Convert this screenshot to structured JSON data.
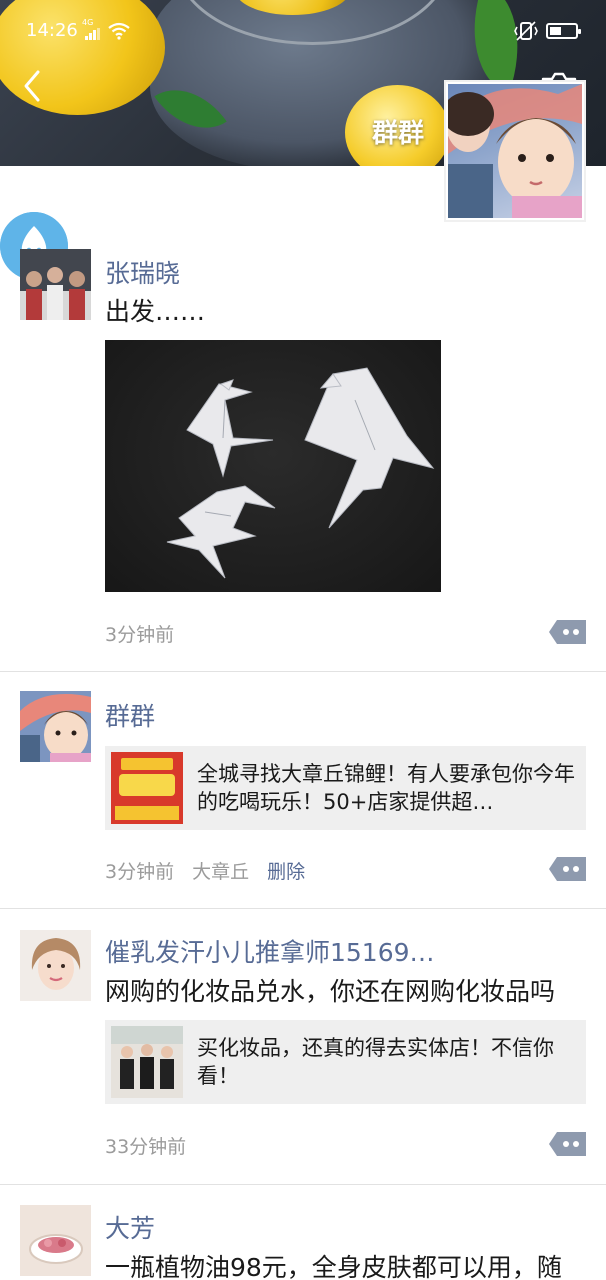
{
  "status_bar": {
    "time": "14:26",
    "network": "4G"
  },
  "cover": {
    "owner_name": "群群"
  },
  "posts": [
    {
      "name": "张瑞晓",
      "text": "出发……",
      "time": "3分钟前"
    },
    {
      "name": "群群",
      "link_title": "全城寻找大章丘锦鲤！有人要承包你今年的吃喝玩乐！50+店家提供超…",
      "link_thumb_text": "大章丘 锦鲤 独宠 1 人",
      "time": "3分钟前",
      "location": "大章丘",
      "delete_label": "删除"
    },
    {
      "name": "催乳发汗小儿推拿师15169…",
      "text": "网购的化妆品兑水，你还在网购化妆品吗",
      "link_title": "买化妆品，还真的得去实体店！不信你看！",
      "time": "33分钟前"
    },
    {
      "name": "大芳",
      "text": "一瓶植物油98元，全身皮肤都可以用，随"
    }
  ],
  "icons": {
    "back": "chevron-left-icon",
    "camera": "camera-icon",
    "more": "comment-more-icon",
    "refresh": "refresh-spinner-icon"
  },
  "colors": {
    "name_link": "#576b95",
    "meta": "#9b9b9b",
    "more_button": "#8e9aae",
    "card_bg": "#efefef"
  }
}
